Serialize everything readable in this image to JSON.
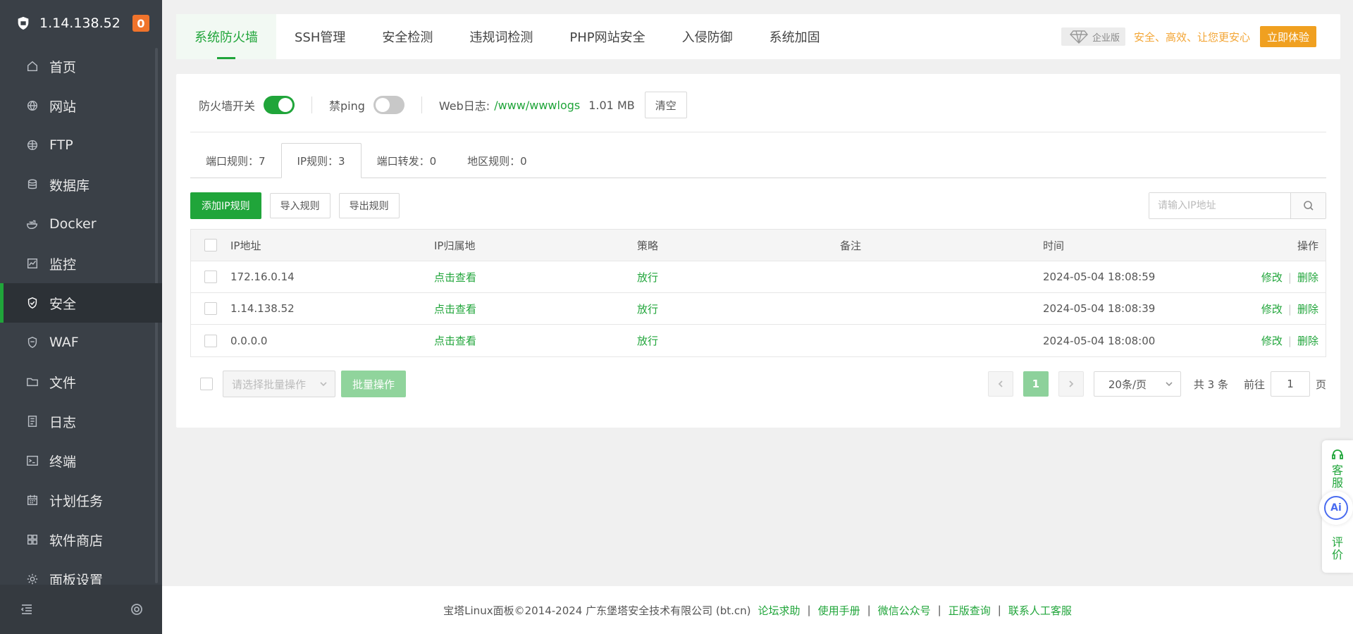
{
  "sidebar": {
    "server_ip": "1.14.138.52",
    "badge_count": "0",
    "items": [
      {
        "label": "首页",
        "icon": "home-icon"
      },
      {
        "label": "网站",
        "icon": "globe-icon"
      },
      {
        "label": "FTP",
        "icon": "ftp-globe-icon"
      },
      {
        "label": "数据库",
        "icon": "database-icon"
      },
      {
        "label": "Docker",
        "icon": "docker-icon"
      },
      {
        "label": "监控",
        "icon": "monitor-chart-icon"
      },
      {
        "label": "安全",
        "icon": "shield-check-icon",
        "active": true
      },
      {
        "label": "WAF",
        "icon": "waf-shield-icon"
      },
      {
        "label": "文件",
        "icon": "folder-icon"
      },
      {
        "label": "日志",
        "icon": "log-icon"
      },
      {
        "label": "终端",
        "icon": "terminal-icon"
      },
      {
        "label": "计划任务",
        "icon": "calendar-icon"
      },
      {
        "label": "软件商店",
        "icon": "grid-apps-icon"
      },
      {
        "label": "面板设置",
        "icon": "gear-icon"
      }
    ]
  },
  "top_tabs": [
    "系统防火墙",
    "SSH管理",
    "安全检测",
    "违规词检测",
    "PHP网站安全",
    "入侵防御",
    "系统加固"
  ],
  "enterprise": {
    "badge": "企业版",
    "slogan": "安全、高效、让您更安心",
    "button": "立即体验"
  },
  "firewall": {
    "switch_label": "防火墙开关",
    "switch_on": true,
    "ping_label": "禁ping",
    "ping_on": false,
    "weblog_label": "Web日志:",
    "weblog_path": "/www/wwwlogs",
    "weblog_size": "1.01 MB",
    "clear_button": "清空"
  },
  "sub_tabs": [
    {
      "label": "端口规则：7"
    },
    {
      "label": "IP规则：3",
      "active": true
    },
    {
      "label": "端口转发：0"
    },
    {
      "label": "地区规则：0"
    }
  ],
  "actions": {
    "add_button": "添加IP规则",
    "import_button": "导入规则",
    "export_button": "导出规则",
    "search_placeholder": "请输入IP地址"
  },
  "table": {
    "headers": [
      "IP地址",
      "IP归属地",
      "策略",
      "备注",
      "时间",
      "操作"
    ],
    "rows": [
      {
        "ip": "172.16.0.14",
        "location": "点击查看",
        "policy": "放行",
        "note": "",
        "time": "2024-05-04 18:08:59",
        "edit": "修改",
        "delete": "删除"
      },
      {
        "ip": "1.14.138.52",
        "location": "点击查看",
        "policy": "放行",
        "note": "",
        "time": "2024-05-04 18:08:39",
        "edit": "修改",
        "delete": "删除"
      },
      {
        "ip": "0.0.0.0",
        "location": "点击查看",
        "policy": "放行",
        "note": "",
        "time": "2024-05-04 18:08:00",
        "edit": "修改",
        "delete": "删除"
      }
    ]
  },
  "bulk": {
    "select_placeholder": "请选择批量操作",
    "button": "批量操作"
  },
  "pager": {
    "current_page": "1",
    "page_size": "20条/页",
    "total": "共 3 条",
    "goto_label": "前往",
    "goto_value": "1",
    "page_suffix": "页"
  },
  "footer": {
    "copyright": "宝塔Linux面板©2014-2024 广东堡塔安全技术有限公司 (bt.cn)",
    "links": [
      "论坛求助",
      "使用手册",
      "微信公众号",
      "正版查询",
      "联系人工客服"
    ]
  },
  "float_widget": {
    "service": "客服",
    "ai": "Ai",
    "rate": "评价"
  },
  "colors": {
    "accent": "#20a53a",
    "sidebar_bg": "#3a4047",
    "badge": "#f0732b",
    "enterprise": "#f0a020"
  }
}
